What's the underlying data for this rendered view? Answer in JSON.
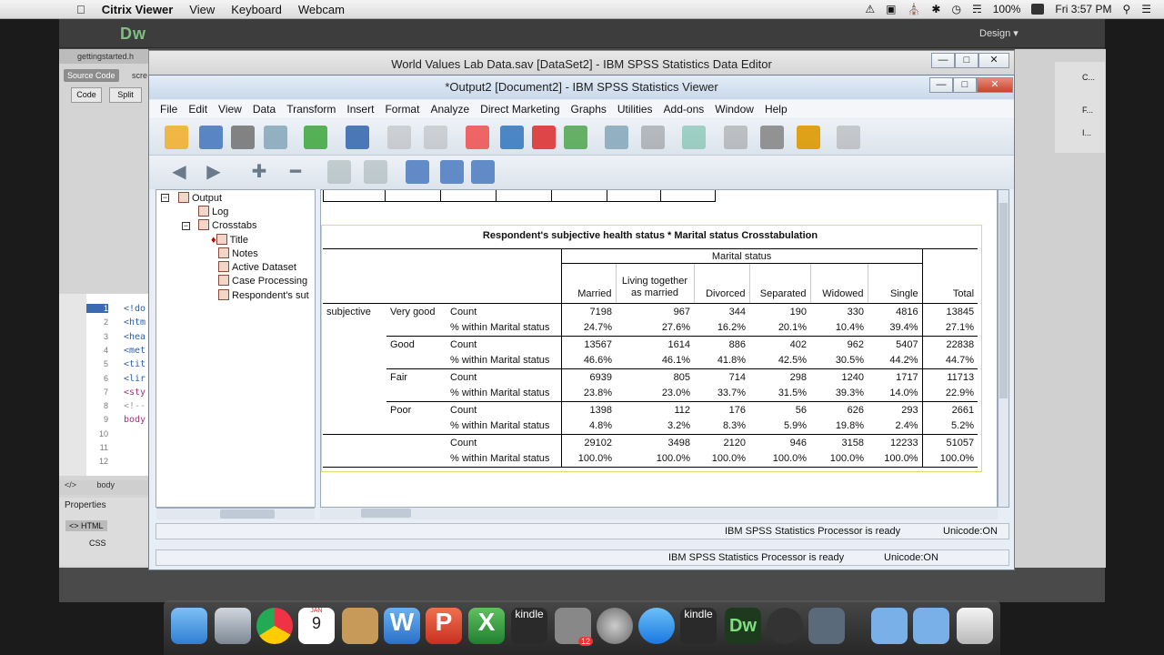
{
  "mac_menubar": {
    "apple": "",
    "items": [
      "Citrix Viewer",
      "View",
      "Keyboard",
      "Webcam"
    ],
    "battery": "100%",
    "clock": "Fri 3:57 PM"
  },
  "dreamweaver": {
    "logo": "Dw",
    "workspace": "Design",
    "file_tab": "gettingstarted.h",
    "file_tab2": "scre",
    "source_code": "Source Code",
    "code_btn": "Code",
    "split_btn": "Split",
    "line_numbers": [
      "1",
      "2",
      "3",
      "4",
      "5",
      "6",
      "7",
      "8",
      "9",
      "10",
      "11",
      "12"
    ],
    "code_lines": [
      "<!do",
      "<htm",
      "<hea",
      "<met",
      "<tit",
      "<lir",
      "<sty",
      "<!--",
      "body",
      "",
      "",
      ""
    ],
    "tag_bar": [
      "</>",
      "body"
    ],
    "properties": "Properties",
    "prop_html": "<> HTML",
    "prop_css": "CSS",
    "right_panel": [
      "C...",
      "F...",
      "I..."
    ]
  },
  "data_editor": {
    "title": "World Values Lab Data.sav [DataSet2] - IBM SPSS Statistics Data Editor"
  },
  "viewer": {
    "title": "*Output2 [Document2] - IBM SPSS Statistics Viewer",
    "menu": [
      "File",
      "Edit",
      "View",
      "Data",
      "Transform",
      "Insert",
      "Format",
      "Analyze",
      "Direct Marketing",
      "Graphs",
      "Utilities",
      "Add-ons",
      "Window",
      "Help"
    ],
    "outline": {
      "output": "Output",
      "log": "Log",
      "crosstabs": "Crosstabs",
      "title": "Title",
      "notes": "Notes",
      "active_dataset": "Active Dataset",
      "case_processing": "Case Processing",
      "respondents": "Respondent's sut"
    },
    "status_inner": "IBM SPSS Statistics Processor is ready",
    "status_inner_unicode": "Unicode:ON",
    "status_outer": "IBM SPSS Statistics Processor is ready",
    "status_outer_unicode": "Unicode:ON"
  },
  "crosstab": {
    "title": "Respondent's subjective health status * Marital status Crosstabulation",
    "group_header": "Marital status",
    "columns": [
      "Married",
      "Living together as married",
      "Divorced",
      "Separated",
      "Widowed",
      "Single",
      "Total"
    ],
    "row_var": "subjective",
    "rows": [
      {
        "cat": "Very good",
        "count": [
          "7198",
          "967",
          "344",
          "190",
          "330",
          "4816",
          "13845"
        ],
        "pct": [
          "24.7%",
          "27.6%",
          "16.2%",
          "20.1%",
          "10.4%",
          "39.4%",
          "27.1%"
        ]
      },
      {
        "cat": "Good",
        "count": [
          "13567",
          "1614",
          "886",
          "402",
          "962",
          "5407",
          "22838"
        ],
        "pct": [
          "46.6%",
          "46.1%",
          "41.8%",
          "42.5%",
          "30.5%",
          "44.2%",
          "44.7%"
        ]
      },
      {
        "cat": "Fair",
        "count": [
          "6939",
          "805",
          "714",
          "298",
          "1240",
          "1717",
          "11713"
        ],
        "pct": [
          "23.8%",
          "23.0%",
          "33.7%",
          "31.5%",
          "39.3%",
          "14.0%",
          "22.9%"
        ]
      },
      {
        "cat": "Poor",
        "count": [
          "1398",
          "112",
          "176",
          "56",
          "626",
          "293",
          "2661"
        ],
        "pct": [
          "4.8%",
          "3.2%",
          "8.3%",
          "5.9%",
          "19.8%",
          "2.4%",
          "5.2%"
        ]
      },
      {
        "cat": "",
        "count": [
          "29102",
          "3498",
          "2120",
          "946",
          "3158",
          "12233",
          "51057"
        ],
        "pct": [
          "100.0%",
          "100.0%",
          "100.0%",
          "100.0%",
          "100.0%",
          "100.0%",
          "100.0%"
        ]
      }
    ],
    "stat_count": "Count",
    "stat_pct": "% within Marital status"
  },
  "dock": {
    "calendar_month": "JAN",
    "calendar_day": "9",
    "launchpad_badge": "12",
    "kindle1": "kindle",
    "kindle2": "kindle",
    "dw": "Dw"
  },
  "colors": {
    "viewer_title": "#c9d8ea",
    "close_button": "#c8442d",
    "dw_logo": "#7fbf7f"
  }
}
